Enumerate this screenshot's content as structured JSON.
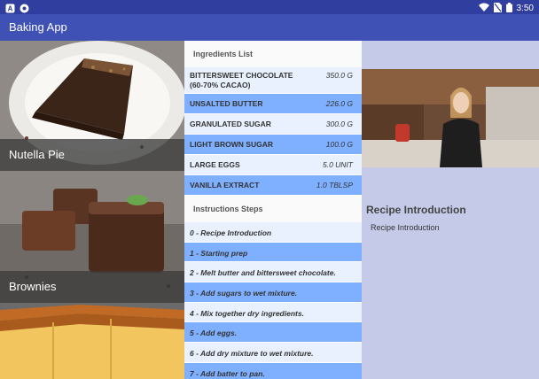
{
  "status_bar": {
    "time": "3:50",
    "left_icons": [
      "notification-a-icon",
      "notification-circle-icon"
    ],
    "right_icons": [
      "wifi-icon",
      "no-sim-icon",
      "battery-icon"
    ]
  },
  "app_bar": {
    "title": "Baking App",
    "color": "#3f51b5"
  },
  "recipes": [
    {
      "name": "Nutella Pie"
    },
    {
      "name": "Brownies"
    },
    {
      "name": ""
    }
  ],
  "ingredients": {
    "title": "Ingredients List",
    "items": [
      {
        "name": "BITTERSWEET CHOCOLATE (60-70% CACAO)",
        "quantity": "350.0 G"
      },
      {
        "name": "UNSALTED BUTTER",
        "quantity": "226.0 G"
      },
      {
        "name": "GRANULATED SUGAR",
        "quantity": "300.0 G"
      },
      {
        "name": "LIGHT BROWN SUGAR",
        "quantity": "100.0 G"
      },
      {
        "name": "LARGE EGGS",
        "quantity": "5.0 UNIT"
      },
      {
        "name": "VANILLA EXTRACT",
        "quantity": "1.0 TBLSP"
      }
    ]
  },
  "instructions": {
    "title": "Instructions Steps",
    "steps": [
      "0 - Recipe Introduction",
      "1 - Starting prep",
      "2 - Melt butter and bittersweet chocolate.",
      "3 - Add sugars to wet mixture.",
      "4 - Mix together dry ingredients.",
      "5 - Add eggs.",
      "6 - Add dry mixture to wet mixture.",
      "7 - Add batter to pan."
    ]
  },
  "selected_step": {
    "title": "Recipe Introduction",
    "description": "Recipe Introduction"
  },
  "colors": {
    "status_bar": "#303f9f",
    "row_light": "#e8f1fd",
    "row_highlight": "#7fb0ff",
    "detail_pane": "#c5cae9"
  }
}
